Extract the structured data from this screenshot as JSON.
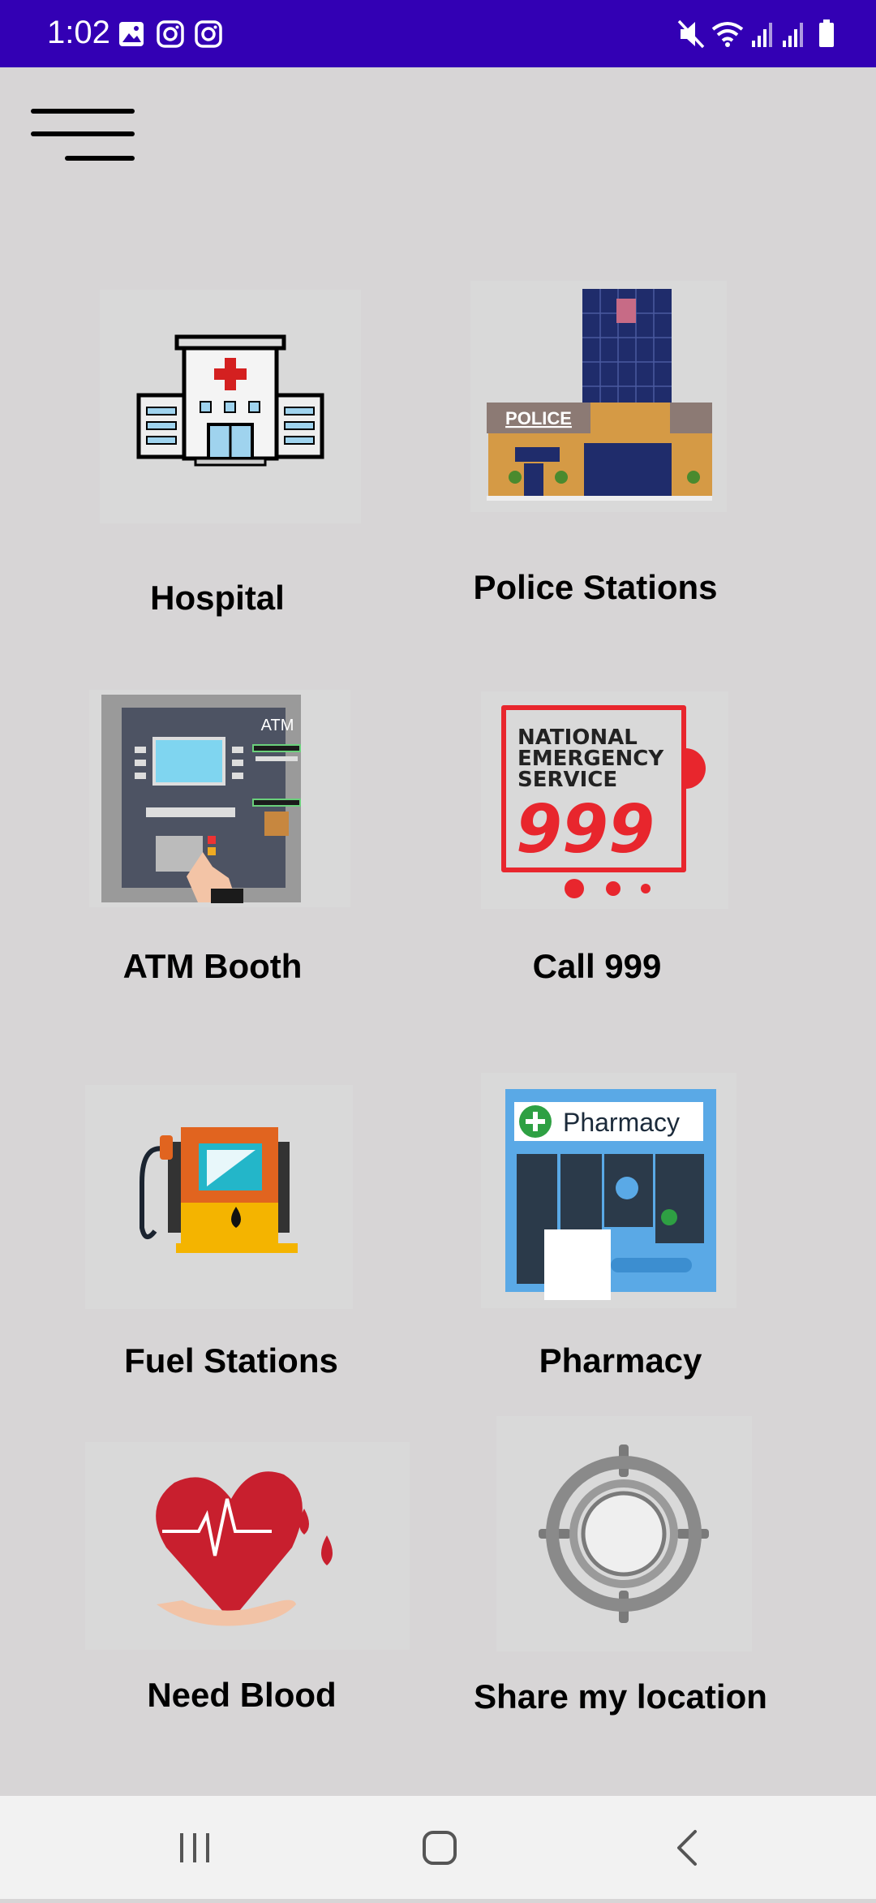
{
  "status_bar": {
    "time": "1:02",
    "left_icons": [
      "gallery-icon",
      "instagram-icon",
      "instagram-icon"
    ],
    "right_icons": [
      "mute-icon",
      "wifi-icon",
      "signal-icon",
      "signal-icon",
      "battery-icon"
    ],
    "background": "#3300b4"
  },
  "menu": {
    "icon": "hamburger-menu-icon"
  },
  "tiles": [
    {
      "label": "Hospital",
      "icon": "hospital-icon"
    },
    {
      "label": "Police Stations",
      "icon": "police-station-icon"
    },
    {
      "label": "ATM Booth",
      "icon": "atm-icon"
    },
    {
      "label": "Call 999",
      "icon": "call-999-icon",
      "sign_lines": [
        "NATIONAL",
        "EMERGENCY",
        "SERVICE"
      ],
      "sign_number": "999"
    },
    {
      "label": "Fuel Stations",
      "icon": "fuel-pump-icon"
    },
    {
      "label": "Pharmacy",
      "icon": "pharmacy-icon",
      "sign_text": "Pharmacy"
    },
    {
      "label": "Need Blood",
      "icon": "blood-heart-icon"
    },
    {
      "label": "Share my location",
      "icon": "location-target-icon"
    }
  ],
  "atm_sign": "ATM",
  "police_sign": "POLICE",
  "nav_bar": {
    "icons": [
      "recent-apps-icon",
      "home-icon",
      "back-icon"
    ]
  }
}
